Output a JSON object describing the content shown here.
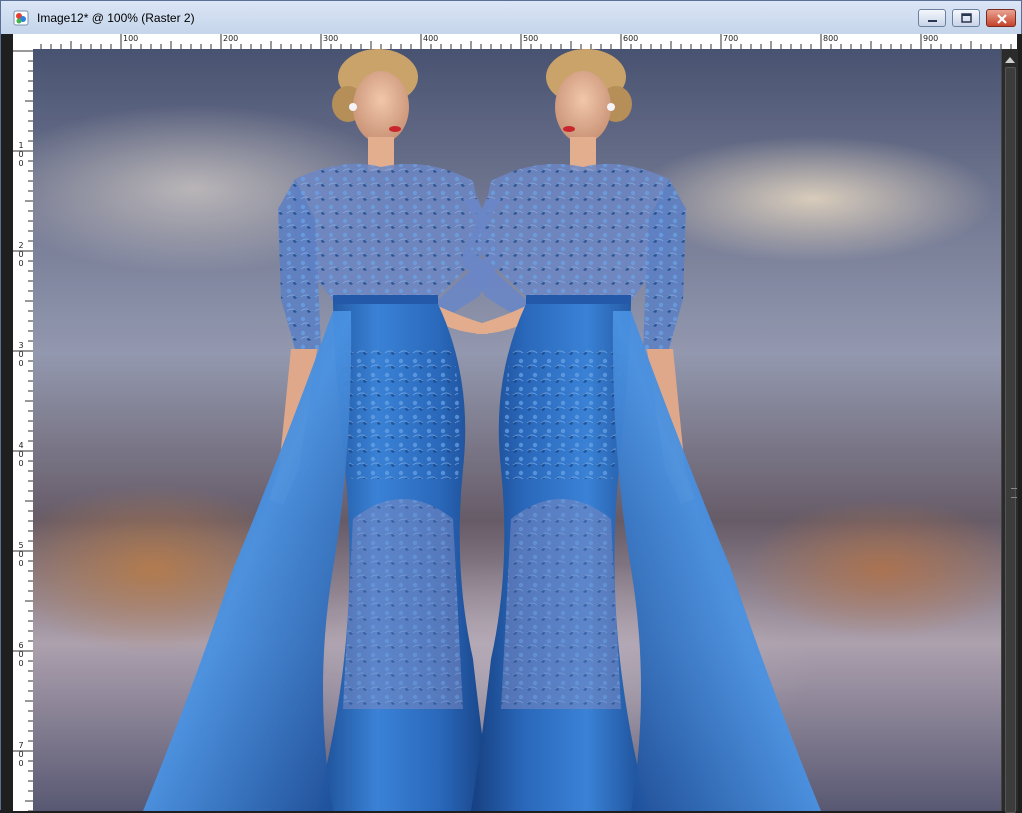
{
  "window": {
    "title": "Image12* @ 100% (Raster 2)",
    "app_icon": "paintshop-pro-icon",
    "controls": {
      "minimize_icon": "minimize-icon",
      "maximize_icon": "maximize-icon",
      "close_icon": "close-icon"
    }
  },
  "ruler_top": {
    "labels": [
      "100",
      "200",
      "300",
      "400",
      "500",
      "600",
      "700",
      "800",
      "900"
    ]
  },
  "ruler_left": {
    "labels": [
      "100",
      "200",
      "300",
      "400",
      "500",
      "600",
      "700"
    ]
  },
  "canvas": {
    "zoom": "100%",
    "layer": "Raster 2"
  },
  "colors": {
    "dress": "#2f6fc0",
    "dress_dark": "#1d4f98",
    "skin": "#e6b596",
    "hair": "#c9a36a",
    "titlebar": "#d4dff0",
    "close": "#c5432b"
  }
}
